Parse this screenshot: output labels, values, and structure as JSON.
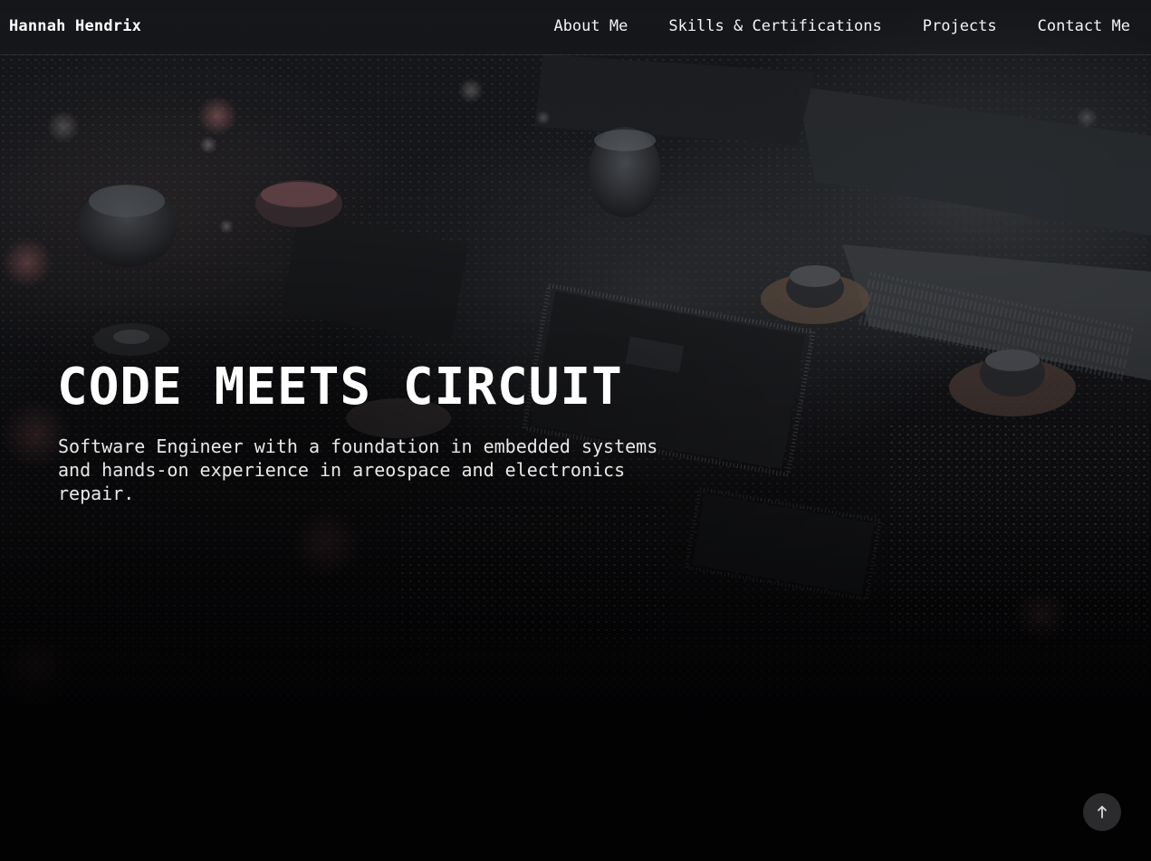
{
  "nav": {
    "brand": "Hannah Hendrix",
    "links": [
      {
        "label": "About Me"
      },
      {
        "label": "Skills & Certifications"
      },
      {
        "label": "Projects"
      },
      {
        "label": "Contact Me"
      }
    ]
  },
  "hero": {
    "title": "CODE MEETS CIRCUIT",
    "subtitle": "Software Engineer with a foundation in embedded systems and hands-on experience in areospace and electronics repair.",
    "background_icon": "circuit-board-image"
  },
  "scroll_top": {
    "icon": "arrow-up-icon"
  },
  "colors": {
    "page_background": "#020203",
    "text": "#ffffff",
    "scroll_button": "#2b2b2d"
  }
}
